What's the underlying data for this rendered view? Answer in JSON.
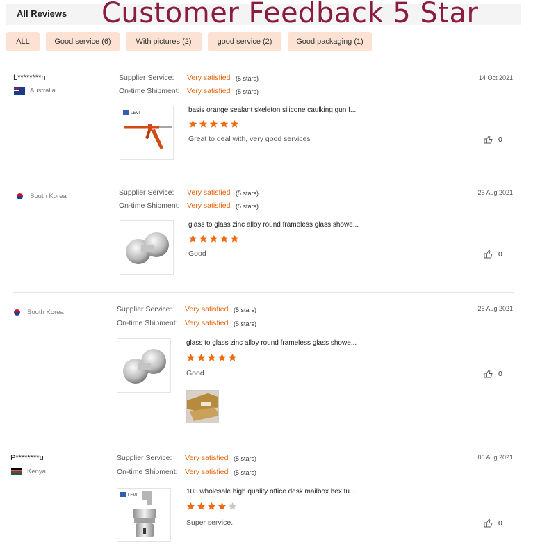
{
  "header": {
    "title": "All Reviews",
    "banner": "Customer Feedback 5 Star"
  },
  "filters": [
    "ALL",
    "Good service (6)",
    "With pictures (2)",
    "good service (2)",
    "Good packaging (1)"
  ],
  "colors": {
    "accent": "#e8620a",
    "chip_bg": "#fbe2d3",
    "banner": "#8a1c3e",
    "star_on": "#f26a10",
    "star_off": "#c8c8c8"
  },
  "labels": {
    "supplier": "Supplier Service:",
    "shipment": "On-time Shipment:"
  },
  "reviews": [
    {
      "user": "L********n",
      "country": "Australia",
      "flag": "flag-australia",
      "date": "14 Oct 2021",
      "supplier_value": "Very satisfied",
      "supplier_stars": "(5 stars)",
      "shipment_value": "Very satisfied",
      "shipment_stars": "(5 stars)",
      "product_title": "basis orange sealant skeleton silicone caulking gun f...",
      "rating": 5,
      "comment": "Great to deal with, very good services",
      "likes": "0",
      "thumb_icon": "caulking-gun-image",
      "brand": "LEVI"
    },
    {
      "user": "",
      "country": "South Korea",
      "flag": "flag-south-korea",
      "date": "26 Aug 2021",
      "supplier_value": "Very satisfied",
      "supplier_stars": "(5 stars)",
      "shipment_value": "Very satisfied",
      "shipment_stars": "(5 stars)",
      "product_title": "glass to glass zinc alloy round frameless glass showe...",
      "rating": 5,
      "comment": "Good",
      "likes": "0",
      "thumb_icon": "glass-clamp-image"
    },
    {
      "user": "",
      "country": "South Korea",
      "flag": "flag-south-korea",
      "date": "26 Aug 2021",
      "supplier_value": "Very satisfied",
      "supplier_stars": "(5 stars)",
      "shipment_value": "Very satisfied",
      "shipment_stars": "(5 stars)",
      "product_title": "glass to glass zinc alloy round frameless glass showe...",
      "rating": 5,
      "comment": "Good",
      "likes": "0",
      "thumb_icon": "glass-clamp-image",
      "has_photo": true
    },
    {
      "user": "P********u",
      "country": "Kenya",
      "flag": "flag-kenya",
      "date": "06 Aug 2021",
      "supplier_value": "Very satisfied",
      "supplier_stars": "(5 stars)",
      "shipment_value": "Very satisfied",
      "shipment_stars": "(5 stars)",
      "product_title": "103 wholesale high quality office desk mailbox hex tu...",
      "rating": 4,
      "comment": "Super service.",
      "likes": "0",
      "thumb_icon": "cam-lock-image",
      "brand": "LEVI"
    }
  ]
}
